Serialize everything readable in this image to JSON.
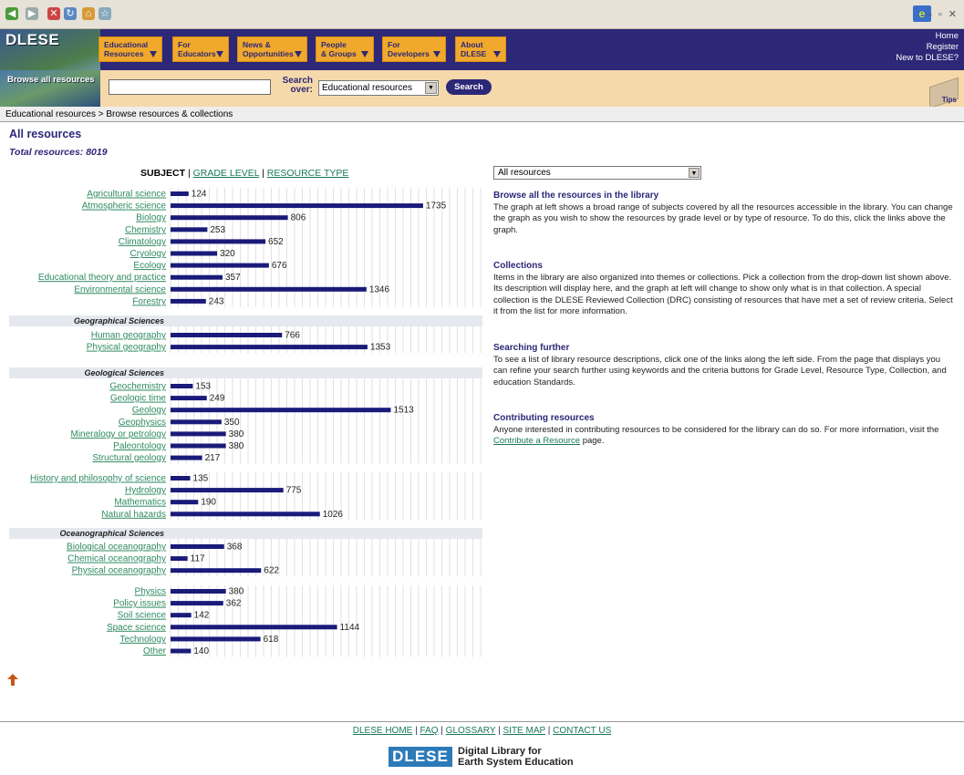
{
  "header": {
    "logo_text": "DLESE",
    "nav": [
      {
        "line1": "Educational",
        "line2": "Resources"
      },
      {
        "line1": "For",
        "line2": "Educators"
      },
      {
        "line1": "News &",
        "line2": "Opportunities"
      },
      {
        "line1": "People",
        "line2": "& Groups"
      },
      {
        "line1": "For",
        "line2": "Developers"
      },
      {
        "line1": "About",
        "line2": "DLESE"
      }
    ],
    "links": [
      "Home",
      "Register",
      "New to DLESE?"
    ]
  },
  "search": {
    "browse_all": "Browse all resources",
    "label": "Search over:",
    "selected": "Educational resources",
    "button": "Search",
    "tips": "Tips",
    "value": ""
  },
  "breadcrumb": "Educational resources > Browse resources & collections",
  "page": {
    "title": "All resources",
    "total": "Total resources: 8019",
    "tab_subject": "SUBJECT",
    "tab_grade": "GRADE LEVEL",
    "tab_type": "RESOURCE TYPE",
    "sep": "|"
  },
  "chart_data": {
    "type": "bar",
    "orientation": "horizontal",
    "title": "",
    "xlim": [
      0,
      1900
    ],
    "grid": true,
    "groups": [
      {
        "header": "",
        "items": [
          {
            "label": "Agricultural science",
            "value": 124
          },
          {
            "label": "Atmospheric science",
            "value": 1735
          },
          {
            "label": "Biology",
            "value": 806
          },
          {
            "label": "Chemistry",
            "value": 253
          },
          {
            "label": "Climatology",
            "value": 652
          },
          {
            "label": "Cryology",
            "value": 320
          },
          {
            "label": "Ecology",
            "value": 676
          },
          {
            "label": "Educational theory and practice",
            "value": 357
          },
          {
            "label": "Environmental science",
            "value": 1346
          },
          {
            "label": "Forestry",
            "value": 243
          }
        ]
      },
      {
        "header": "Geographical Sciences",
        "items": [
          {
            "label": "Human geography",
            "value": 766
          },
          {
            "label": "Physical geography",
            "value": 1353
          }
        ]
      },
      {
        "header": "Geological Sciences",
        "items": [
          {
            "label": "Geochemistry",
            "value": 153
          },
          {
            "label": "Geologic time",
            "value": 249
          },
          {
            "label": "Geology",
            "value": 1513
          },
          {
            "label": "Geophysics",
            "value": 350
          },
          {
            "label": "Mineralogy or petrology",
            "value": 380
          },
          {
            "label": "Paleontology",
            "value": 380
          },
          {
            "label": "Structural geology",
            "value": 217
          }
        ]
      },
      {
        "header": "",
        "items": [
          {
            "label": "History and philosophy of science",
            "value": 135
          },
          {
            "label": "Hydrology",
            "value": 775
          },
          {
            "label": "Mathematics",
            "value": 190
          },
          {
            "label": "Natural hazards",
            "value": 1026
          }
        ]
      },
      {
        "header": "Oceanographical Sciences",
        "items": [
          {
            "label": "Biological oceanography",
            "value": 368
          },
          {
            "label": "Chemical oceanography",
            "value": 117
          },
          {
            "label": "Physical oceanography",
            "value": 622
          }
        ]
      },
      {
        "header": "",
        "items": [
          {
            "label": "Physics",
            "value": 380
          },
          {
            "label": "Policy issues",
            "value": 362
          },
          {
            "label": "Soil science",
            "value": 142
          },
          {
            "label": "Space science",
            "value": 1144
          },
          {
            "label": "Technology",
            "value": 618
          },
          {
            "label": "Other",
            "value": 140
          }
        ]
      }
    ],
    "bar_color": "#1a1a7a"
  },
  "right": {
    "select": "All resources",
    "s1_title": "Browse all the resources in the library",
    "s1_text": "The graph at left shows a broad range of subjects covered by all the resources accessible in the library. You can change the graph as you wish to show the resources by grade level or by type of resource. To do this, click the links above the graph.",
    "s2_title": "Collections",
    "s2_text": "Items in the library are also organized into themes or collections. Pick a collection from the drop-down list shown above. Its description will display here, and the graph at left will change to show only what is in that collection. A special collection is the DLESE Reviewed Collection (DRC) consisting of resources that have met a set of review criteria. Select it from the list for more information.",
    "s3_title": "Searching further",
    "s3_text": "To see a list of library resource descriptions, click one of the links along the left side. From the page that displays you can refine your search further using keywords and the criteria buttons for Grade Level, Resource Type, Collection, and education Standards.",
    "s4_title": "Contributing resources",
    "s4_text_a": "Anyone interested in contributing resources to be considered for the library can do so. For more information, visit the",
    "s4_link": "Contribute a Resource",
    "s4_text_b": "page."
  },
  "footer": {
    "links": [
      "DLESE HOME",
      "FAQ",
      "GLOSSARY",
      "SITE MAP",
      "CONTACT US"
    ],
    "logo": "DLESE",
    "tag1": "Digital Library for",
    "tag2": "Earth System Education"
  },
  "colors": {
    "navy": "#2d2777",
    "orange": "#f0a92c",
    "link": "#1a7a5a"
  }
}
